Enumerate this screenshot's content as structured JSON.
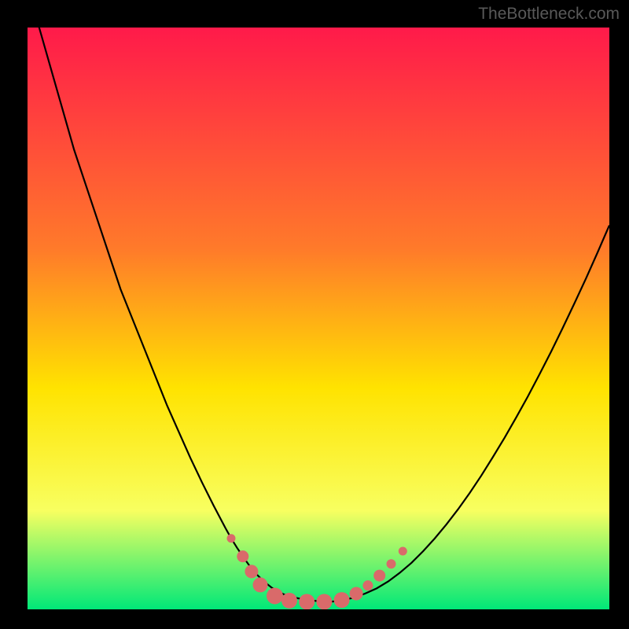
{
  "watermark": "TheBottleneck.com",
  "colors": {
    "bg": "#000000",
    "gradient_top": "#ff1a4a",
    "gradient_mid1": "#ff7a2a",
    "gradient_mid2": "#ffe300",
    "gradient_mid3": "#f8ff60",
    "gradient_bottom": "#00e878",
    "curve": "#000000",
    "marker_fill": "#d96a6a",
    "marker_stroke": "#c05050"
  },
  "chart_data": {
    "type": "line",
    "title": "",
    "xlabel": "",
    "ylabel": "",
    "xlim": [
      0,
      100
    ],
    "ylim": [
      0,
      100
    ],
    "curve": {
      "name": "bottleneck-curve",
      "x": [
        0,
        2,
        4,
        6,
        8,
        10,
        12,
        14,
        16,
        18,
        20,
        22,
        24,
        26,
        28,
        30,
        32,
        34,
        35,
        36,
        37,
        38,
        39,
        40,
        41,
        42,
        43,
        44,
        46,
        48,
        50,
        52,
        54,
        56,
        58,
        60,
        62,
        64,
        66,
        68,
        70,
        72,
        74,
        76,
        78,
        80,
        82,
        84,
        86,
        88,
        90,
        92,
        94,
        96,
        98,
        100
      ],
      "y": [
        150,
        100,
        93,
        86,
        79,
        73,
        67,
        61,
        55,
        50,
        45,
        40,
        35,
        30.5,
        26,
        21.8,
        17.8,
        14,
        12.2,
        10.6,
        9.1,
        7.7,
        6.4,
        5.4,
        4.5,
        3.7,
        3.1,
        2.6,
        2,
        1.6,
        1.4,
        1.3,
        1.5,
        2,
        2.7,
        3.6,
        4.8,
        6.3,
        8,
        10,
        12.2,
        14.6,
        17.2,
        20,
        23,
        26.2,
        29.5,
        33,
        36.6,
        40.4,
        44.3,
        48.4,
        52.6,
        56.9,
        61.4,
        66
      ]
    },
    "markers": {
      "name": "highlight-points",
      "points": [
        {
          "x": 35,
          "y": 12.2,
          "r": 5.5
        },
        {
          "x": 37,
          "y": 9.1,
          "r": 7.5
        },
        {
          "x": 38.5,
          "y": 6.5,
          "r": 8.5
        },
        {
          "x": 40,
          "y": 4.2,
          "r": 9.5
        },
        {
          "x": 42.5,
          "y": 2.3,
          "r": 10.5
        },
        {
          "x": 45,
          "y": 1.5,
          "r": 10
        },
        {
          "x": 48,
          "y": 1.3,
          "r": 10
        },
        {
          "x": 51,
          "y": 1.3,
          "r": 10
        },
        {
          "x": 54,
          "y": 1.6,
          "r": 10
        },
        {
          "x": 56.5,
          "y": 2.7,
          "r": 8.5
        },
        {
          "x": 58.5,
          "y": 4.1,
          "r": 6.5
        },
        {
          "x": 60.5,
          "y": 5.8,
          "r": 7.5
        },
        {
          "x": 62.5,
          "y": 7.8,
          "r": 6
        },
        {
          "x": 64.5,
          "y": 10,
          "r": 5.5
        }
      ]
    }
  }
}
